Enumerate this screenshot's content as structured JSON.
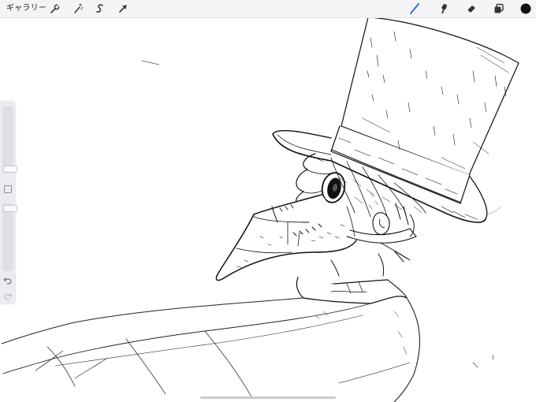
{
  "toolbar": {
    "gallery_label": "ギャラリー",
    "left_tools": [
      {
        "name": "actions",
        "icon": "wrench-icon"
      },
      {
        "name": "adjustments",
        "icon": "magic-wand-icon"
      },
      {
        "name": "selection",
        "icon": "selection-s-icon"
      },
      {
        "name": "transform",
        "icon": "arrow-cursor-icon"
      }
    ],
    "right_tools": [
      {
        "name": "brush",
        "icon": "brush-icon",
        "active": true
      },
      {
        "name": "smudge",
        "icon": "smudge-icon"
      },
      {
        "name": "eraser",
        "icon": "eraser-icon"
      },
      {
        "name": "layers",
        "icon": "layers-icon"
      },
      {
        "name": "color",
        "icon": "color-swatch"
      }
    ],
    "accent_color": "#2f6ee0",
    "current_color": "#111111"
  },
  "sidebar": {
    "brush_size_level": 0.32,
    "opacity_level": 0.96,
    "buttons": [
      "modify-button",
      "undo-icon",
      "redo-icon"
    ]
  },
  "canvas": {
    "background": "#ffffff",
    "artwork": "plague-doctor-top-hat-ink-drawing"
  }
}
